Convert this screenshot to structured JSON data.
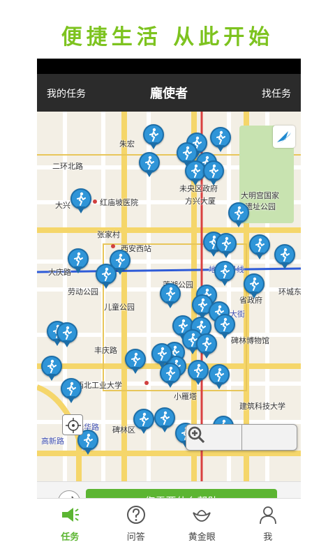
{
  "slogan": "便捷生活 从此开始",
  "header": {
    "left": "我的任务",
    "title": "龐使者",
    "right": "找任务"
  },
  "map": {
    "labels": [
      {
        "text": "朱宏",
        "cls": ""
      },
      {
        "text": "二环北路",
        "cls": ""
      },
      {
        "text": "大兴",
        "cls": ""
      },
      {
        "text": "红庙坡医院",
        "cls": ""
      },
      {
        "text": "未央区政府",
        "cls": ""
      },
      {
        "text": "方兴大厦",
        "cls": ""
      },
      {
        "text": "大明宫国家",
        "cls": ""
      },
      {
        "text": "遗址公园",
        "cls": ""
      },
      {
        "text": "张家村",
        "cls": ""
      },
      {
        "text": "西安西站",
        "cls": ""
      },
      {
        "text": "大庆路",
        "cls": ""
      },
      {
        "text": "劳动公园",
        "cls": ""
      },
      {
        "text": "莲湖公园",
        "cls": ""
      },
      {
        "text": "儿童公园",
        "cls": ""
      },
      {
        "text": "省政府",
        "cls": ""
      },
      {
        "text": "环城东路",
        "cls": ""
      },
      {
        "text": "丰庆路",
        "cls": ""
      },
      {
        "text": "碑林博物馆",
        "cls": ""
      },
      {
        "text": "西北工业大学",
        "cls": ""
      },
      {
        "text": "小雁塔",
        "cls": ""
      },
      {
        "text": "建筑科技大学",
        "cls": ""
      },
      {
        "text": "碑林区",
        "cls": ""
      },
      {
        "text": "高新路",
        "cls": "blue"
      },
      {
        "text": "光华路",
        "cls": "blue"
      },
      {
        "text": "大街",
        "cls": "blue"
      },
      {
        "text": "地铁2号线",
        "cls": "blue"
      }
    ],
    "pin_count": 44
  },
  "help": {
    "button_label": "您需要什么帮助"
  },
  "tabs": [
    {
      "label": "任务",
      "icon": "megaphone-icon",
      "active": true
    },
    {
      "label": "问答",
      "icon": "question-icon",
      "active": false
    },
    {
      "label": "黄金眼",
      "icon": "ingot-icon",
      "active": false
    },
    {
      "label": "我",
      "icon": "person-icon",
      "active": false
    }
  ],
  "colors": {
    "accent": "#5cb532",
    "slogan": "#7dc31f",
    "pin": "#2f95d8",
    "header": "#2b2b2b"
  }
}
